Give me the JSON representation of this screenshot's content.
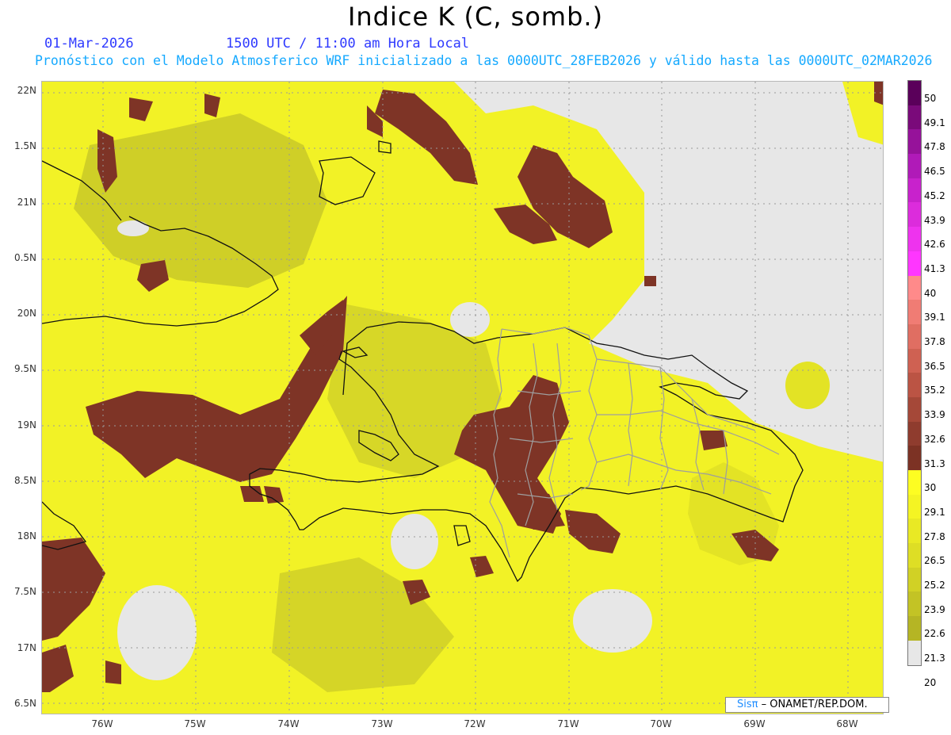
{
  "header": {
    "title": "Indice K (C, somb.)",
    "date": "01-Mar-2026",
    "time": "1500 UTC / 11:00 am Hora Local",
    "info": "Pronóstico con el Modelo Atmosferico WRF inicializado a las 0000UTC_28FEB2026 y válido hasta las  0000UTC_02MAR2026"
  },
  "axes": {
    "lat_labels": [
      "22N",
      "1.5N",
      "21N",
      "0.5N",
      "20N",
      "9.5N",
      "19N",
      "8.5N",
      "18N",
      "7.5N",
      "17N",
      "6.5N"
    ],
    "lon_labels": [
      "76W",
      "75W",
      "74W",
      "73W",
      "72W",
      "71W",
      "70W",
      "69W",
      "68W"
    ]
  },
  "colorbar": {
    "labels": [
      "50",
      "49.1",
      "47.8",
      "46.5",
      "45.2",
      "43.9",
      "42.6",
      "41.3",
      "40",
      "39.1",
      "37.8",
      "36.5",
      "35.2",
      "33.9",
      "32.6",
      "31.3",
      "30",
      "29.1",
      "27.8",
      "26.5",
      "25.2",
      "23.9",
      "22.6",
      "21.3",
      "20"
    ],
    "colors": [
      "#5a005a",
      "#7a0a7a",
      "#96129a",
      "#b01ab8",
      "#c822cc",
      "#dc2cdc",
      "#ee33ee",
      "#ff36ff",
      "#ff8a8a",
      "#f07c74",
      "#e06e62",
      "#cf6152",
      "#bb5444",
      "#a54838",
      "#8f3c2e",
      "#7c3224",
      "#fdfd22",
      "#f4f423",
      "#e9e924",
      "#dede25",
      "#d1d125",
      "#c3c325",
      "#b5b524",
      "#e7e7e7"
    ]
  },
  "credit": {
    "brand": "Sisπ",
    "text": "– ONAMET/REP.DOM."
  },
  "colors": {
    "low": "#e7e7e7",
    "yellow_bright": "#f2f226",
    "yellow_mid": "#d6d628",
    "olive": "#bcbc28",
    "brown": "#7e3426",
    "brown_dark": "#6e2a1e",
    "coast": "#111111",
    "border": "#9e9e9e"
  }
}
